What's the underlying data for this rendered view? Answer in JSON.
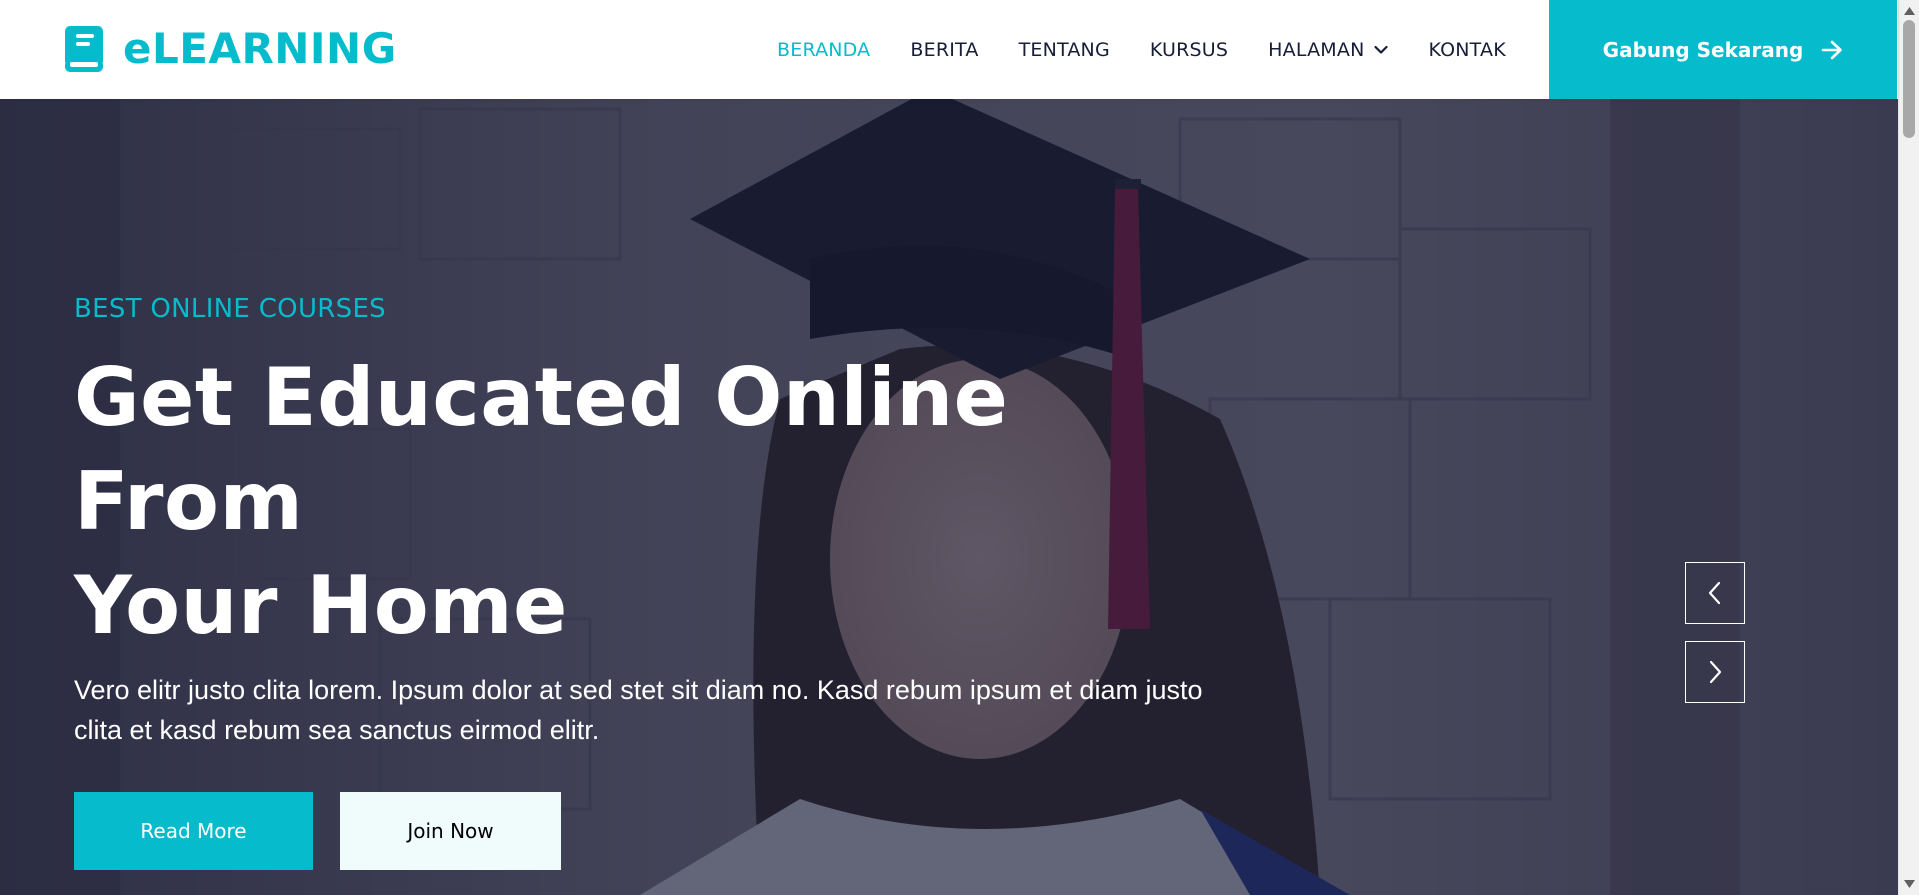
{
  "brand": {
    "name": "eLEARNING",
    "icon": "book-icon"
  },
  "nav": {
    "items": [
      {
        "label": "BERANDA",
        "active": true
      },
      {
        "label": "BERITA",
        "active": false
      },
      {
        "label": "TENTANG",
        "active": false
      },
      {
        "label": "KURSUS",
        "active": false
      },
      {
        "label": "HALAMAN",
        "active": false,
        "has_dropdown": true
      },
      {
        "label": "KONTAK",
        "active": false
      }
    ],
    "cta_label": "Gabung Sekarang",
    "cta_icon": "arrow-right-icon"
  },
  "hero": {
    "kicker": "BEST ONLINE COURSES",
    "title_line1": "Get Educated Online From",
    "title_line2": "Your Home",
    "text_line1": "Vero elitr justo clita lorem. Ipsum dolor at sed stet sit diam no. Kasd rebum ipsum et diam justo",
    "text_line2": "clita et kasd rebum sea sanctus eirmod elitr.",
    "primary_button": "Read More",
    "secondary_button": "Join Now",
    "prev_icon": "chevron-left-icon",
    "next_icon": "chevron-right-icon"
  },
  "colors": {
    "accent": "#06bbcc",
    "dark": "#181d38",
    "overlay": "rgba(24, 29, 56, 0.66)"
  }
}
